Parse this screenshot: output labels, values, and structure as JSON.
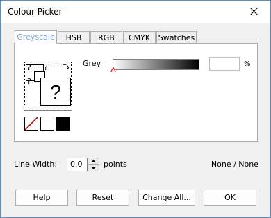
{
  "window": {
    "title": "Colour Picker"
  },
  "tabs": [
    {
      "label": "Greyscale",
      "active": true
    },
    {
      "label": "HSB",
      "active": false
    },
    {
      "label": "RGB",
      "active": false
    },
    {
      "label": "CMYK",
      "active": false
    },
    {
      "label": "Swatches",
      "active": false
    }
  ],
  "preview": {
    "question_mark": "?"
  },
  "grey": {
    "label": "Grey",
    "value": "",
    "unit": "%",
    "slider_level": 0
  },
  "line_width": {
    "label": "Line Width:",
    "value": "0.0",
    "unit": "points"
  },
  "status_text": "None / None",
  "buttons": {
    "help": "Help",
    "reset": "Reset",
    "change_all": "Change All...",
    "ok": "OK"
  },
  "colors": {
    "active_tab_text": "#7aa7d8",
    "window_border": "#5a8fc8",
    "none_swatch_slash": "#b00000"
  }
}
